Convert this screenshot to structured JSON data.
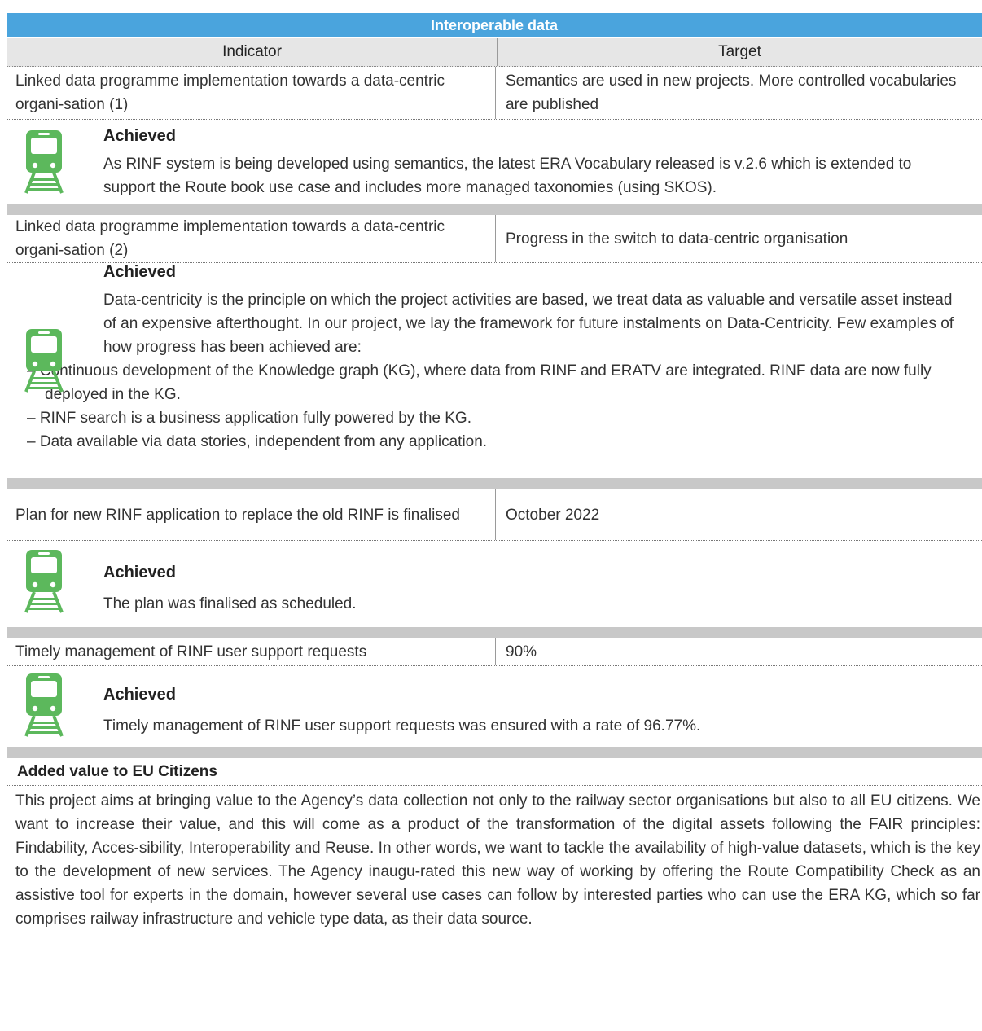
{
  "table": {
    "title": "Interoperable data",
    "header": {
      "indicator": "Indicator",
      "target": "Target"
    }
  },
  "rows": [
    {
      "indicator": "Linked data programme implementation towards a data-centric organi-sation (1)",
      "target": "Semantics are used in new projects. More controlled vocabularies are published",
      "status": "Achieved",
      "text": "As RINF system is being developed using semantics, the latest ERA Vocabulary released is v.2.6 which is extended to support the Route book use case and includes more managed taxonomies (using SKOS)."
    },
    {
      "indicator": "Linked data programme implementation towards a data-centric organi-sation (2)",
      "target": "Progress in the switch to data-centric organisation",
      "status": "Achieved",
      "text": "Data-centricity is the principle on which the project activities are based, we treat data as valuable and versatile asset instead of an expensive afterthought. In our project, we lay the framework for future instalments on Data-Centricity. Few examples of how progress has been achieved are:",
      "bullets": [
        "– Continuous development of the Knowledge graph (KG), where data from RINF and ERATV are integrated. RINF data are now fully deployed in the KG.",
        "– RINF search is a business application fully powered by the KG.",
        "– Data available via data stories, independent from any application."
      ]
    },
    {
      "indicator": "Plan for new RINF application to replace the old RINF is finalised",
      "target": "October 2022",
      "status": "Achieved",
      "text": "The plan was finalised as scheduled."
    },
    {
      "indicator": "Timely management of RINF user support requests",
      "target": "90%",
      "status": "Achieved",
      "text": "Timely management of RINF user support requests was ensured with a rate of 96.77%."
    }
  ],
  "added_value": {
    "title": "Added value to EU Citizens",
    "text": "This project aims at bringing value to the Agency’s data collection not only to the railway sector organisations but also to all EU citizens. We want to increase their value, and this will come as a product of the transformation of the digital assets following the FAIR principles: Findability, Acces-sibility, Interoperability and Reuse. In other words, we want to tackle the availability of high-value datasets, which is the key to the development of new services. The Agency inaugu-rated this new way of working by offering the Route Compatibility Check as an assistive tool for experts in the domain, however several use cases can follow by interested parties who can use the ERA KG, which so far comprises railway infrastructure and vehicle type data, as their data source."
  },
  "colors": {
    "title_bar": "#4aa4dd",
    "header_bg": "#e6e6e6",
    "separator": "#c8c8c8",
    "train_icon": "#5cb85c"
  },
  "icon": "train-icon"
}
